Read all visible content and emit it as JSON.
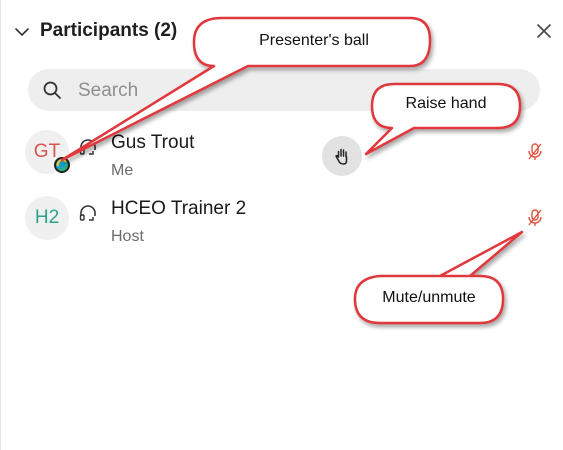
{
  "panel": {
    "title": "Participants (2)",
    "search": {
      "placeholder": "Search"
    }
  },
  "participants": [
    {
      "initials": "GT",
      "name": "Gus Trout",
      "role": "Me",
      "initials_color": "#d9534f",
      "has_presenter_ball": true,
      "hand_raised_control": true,
      "muted": true
    },
    {
      "initials": "H2",
      "name": "HCEO Trainer 2",
      "role": "Host",
      "initials_color": "#2aa58c",
      "has_presenter_ball": false,
      "hand_raised_control": false,
      "muted": true
    }
  ],
  "icons": {
    "collapse": "chevron-down-icon",
    "close": "close-icon",
    "search": "search-icon",
    "audio": "headset-icon",
    "presenter": "presenter-ball-icon",
    "raise_hand": "hand-icon",
    "mute": "microphone-muted-icon"
  },
  "callouts": {
    "presenter_ball": "Presenter's ball",
    "raise_hand": "Raise hand",
    "mute_unmute": "Mute/unmute"
  },
  "colors": {
    "callout_border": "#e0383e",
    "muted_icon": "#e0533e",
    "search_bg": "#eeeeee"
  }
}
